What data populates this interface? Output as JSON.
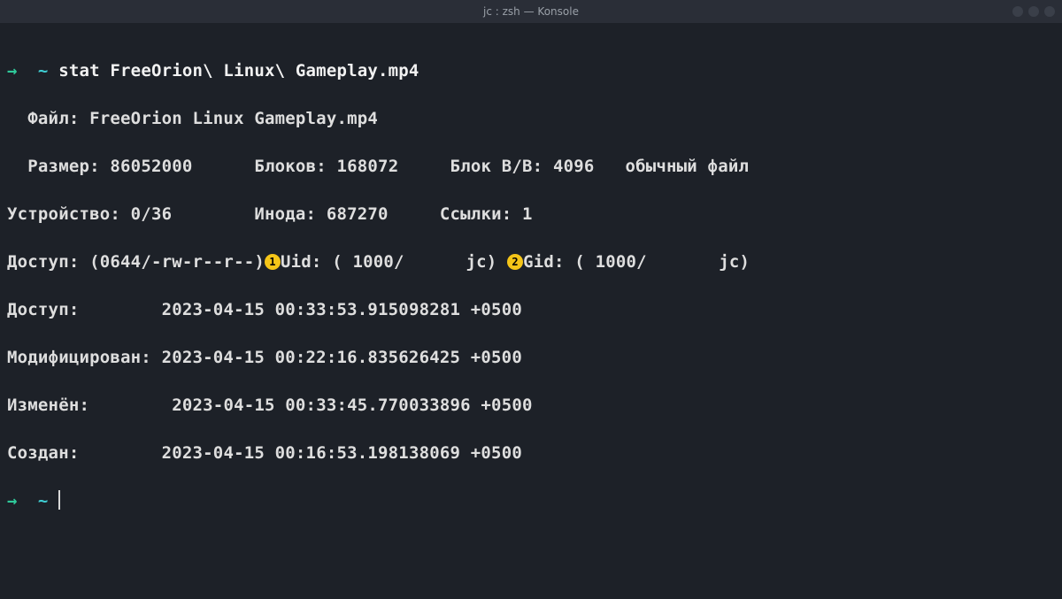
{
  "titlebar": {
    "title": "jc : zsh — Konsole"
  },
  "prompt": {
    "arrow": "→",
    "tilde": "~"
  },
  "command": "stat FreeOrion\\ Linux\\ Gameplay.mp4",
  "badges": {
    "b1": "1",
    "b2": "2"
  },
  "out": {
    "file_label": "Файл:",
    "file_value": "FreeOrion Linux Gameplay.mp4",
    "size_label": "Размер:",
    "size_value": "86052000",
    "blocks_label": "Блоков:",
    "blocks_value": "168072",
    "ioblock_label": "Блок В/В:",
    "ioblock_value": "4096",
    "filetype": "обычный файл",
    "device_label": "Устройство:",
    "device_value": "0/36",
    "inode_label": "Инода:",
    "inode_value": "687270",
    "links_label": "Ссылки:",
    "links_value": "1",
    "access_perm_label": "Доступ:",
    "access_perm_value": "(0644/-rw-r--r--)",
    "uid_label": "Uid:",
    "uid_value": "( 1000/",
    "uid_name": "jc)",
    "gid_label": "Gid:",
    "gid_value": "( 1000/",
    "gid_name": "jc)",
    "atime_label": "Доступ:",
    "atime_value": "2023-04-15 00:33:53.915098281 +0500",
    "mtime_label": "Модифицирован:",
    "mtime_value": "2023-04-15 00:22:16.835626425 +0500",
    "ctime_label": "Изменён:",
    "ctime_value": "2023-04-15 00:33:45.770033896 +0500",
    "btime_label": "Создан:",
    "btime_value": "2023-04-15 00:16:53.198138069 +0500"
  }
}
